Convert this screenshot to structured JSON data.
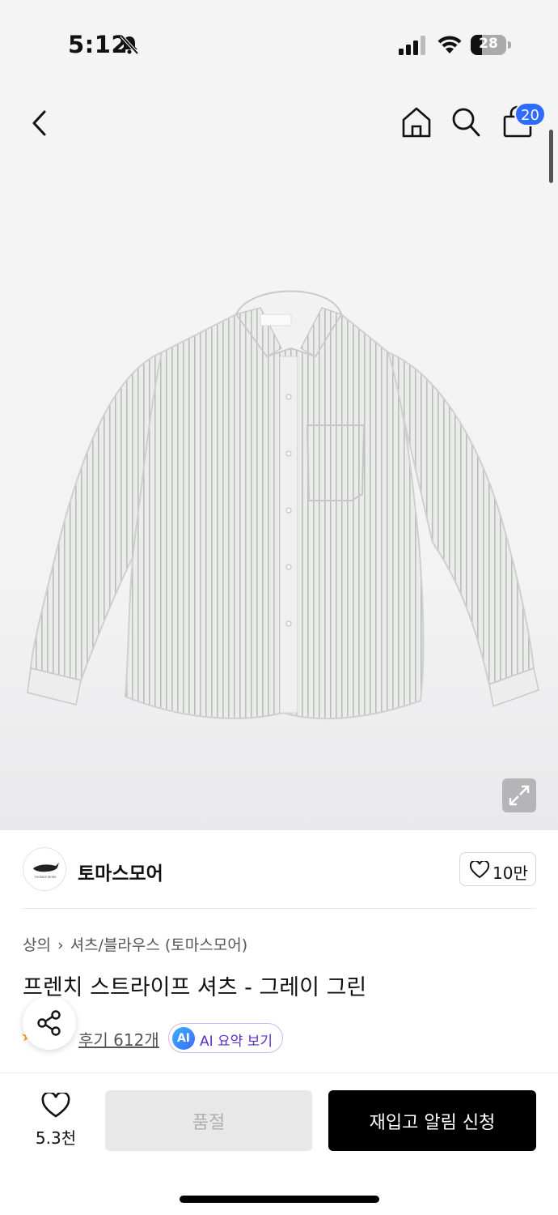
{
  "status_bar": {
    "time": "5:12",
    "battery": "28"
  },
  "nav": {
    "cart_count": "20"
  },
  "brand": {
    "name": "토마스모어",
    "logo_text": "THOMAS MORE",
    "likes": "10만"
  },
  "product": {
    "breadcrumb": [
      "상의",
      "셔츠/블라우스 (토마스모어)"
    ],
    "title": "프렌치 스트라이프 셔츠 - 그레이 그린",
    "reviews": "후기 612개",
    "ai_badge": "AI",
    "ai_summary": "AI 요약 보기"
  },
  "bottom_bar": {
    "wish_count": "5.3천",
    "soldout_label": "품절",
    "restock_label": "재입고 알림 신청"
  },
  "colors": {
    "accent": "#2f6bff",
    "ai_purple": "#5b2fc9",
    "primary_button": "#000000"
  }
}
